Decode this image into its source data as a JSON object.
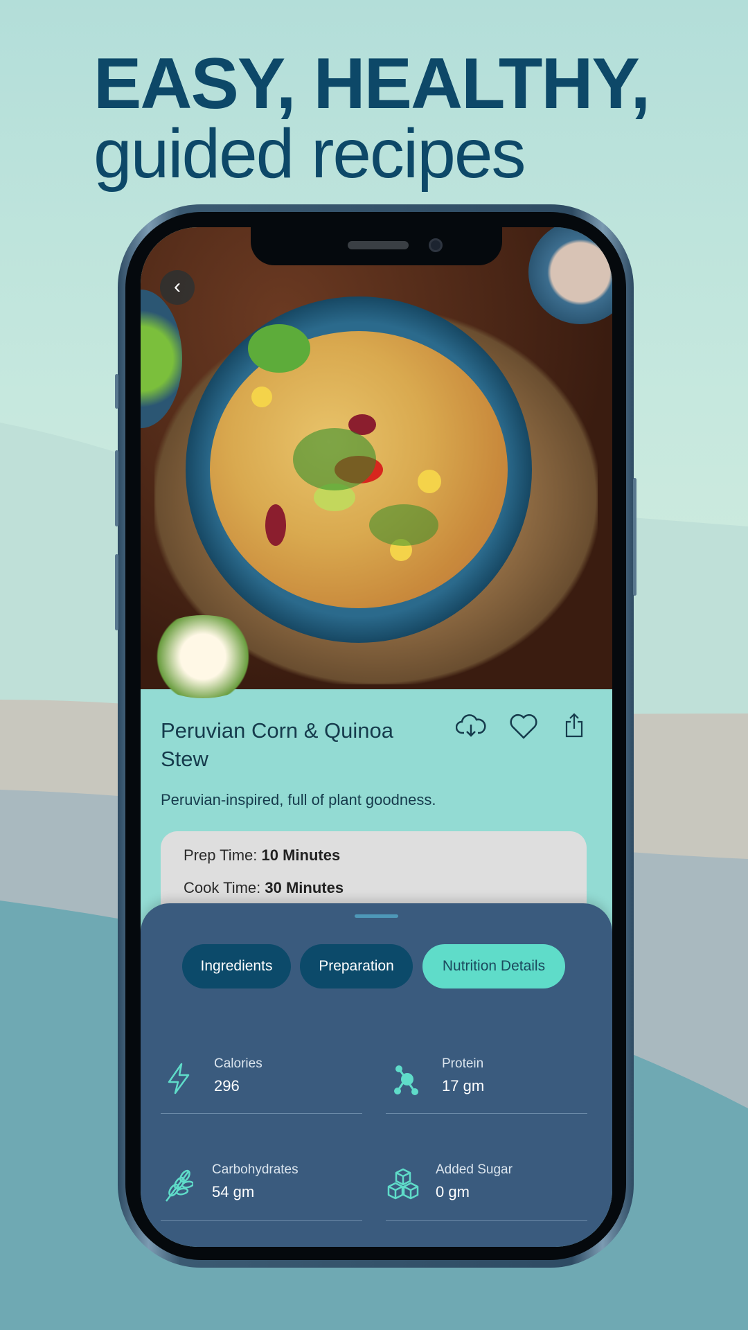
{
  "headline": {
    "line1": "EASY, HEALTHY,",
    "line2": "guided recipes"
  },
  "recipe": {
    "title": "Peruvian Corn & Quinoa Stew",
    "description": "Peruvian-inspired, full of plant goodness.",
    "prep_label": "Prep Time:",
    "prep_value": "10 Minutes",
    "cook_label": "Cook Time:",
    "cook_value": "30 Minutes"
  },
  "actions": {
    "icons": [
      "back-chevron-icon",
      "cloud-download-icon",
      "heart-icon",
      "share-icon"
    ]
  },
  "tabs": [
    {
      "label": "Ingredients",
      "active": false
    },
    {
      "label": "Preparation",
      "active": false
    },
    {
      "label": "Nutrition Details",
      "active": true
    }
  ],
  "nutrition": [
    {
      "label": "Calories",
      "value": "296",
      "icon": "lightning-icon"
    },
    {
      "label": "Protein",
      "value": "17 gm",
      "icon": "molecule-icon"
    },
    {
      "label": "Carbohydrates",
      "value": "54 gm",
      "icon": "wheat-icon"
    },
    {
      "label": "Added Sugar",
      "value": "0 gm",
      "icon": "sugar-cubes-icon"
    }
  ],
  "colors": {
    "headline": "#0d4868",
    "info_bg": "#93dbd3",
    "sheet_bg": "#3a5b7e",
    "tab": "#0c4a6a",
    "tab_active": "#5fdcc9",
    "icon_accent": "#5fdcc9"
  }
}
